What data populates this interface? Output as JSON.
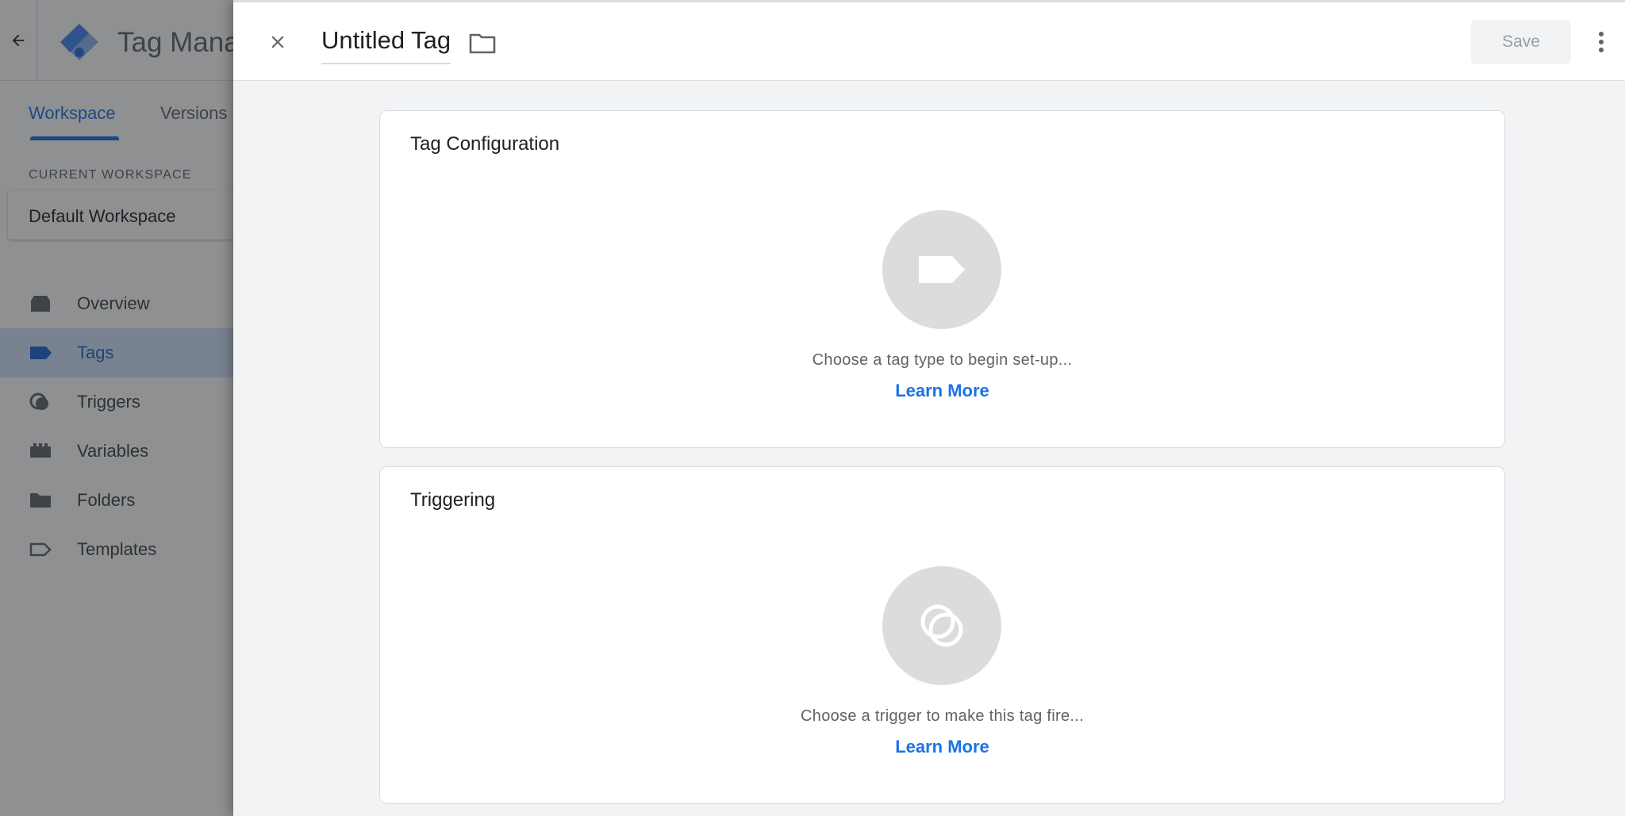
{
  "app": {
    "title": "Tag Manager",
    "tabs": [
      {
        "label": "Workspace"
      },
      {
        "label": "Versions"
      }
    ],
    "current_workspace_label": "CURRENT WORKSPACE",
    "current_workspace_name": "Default Workspace",
    "nav": [
      {
        "label": "Overview",
        "icon": "overview-icon"
      },
      {
        "label": "Tags",
        "icon": "tag-icon",
        "active": true
      },
      {
        "label": "Triggers",
        "icon": "trigger-icon"
      },
      {
        "label": "Variables",
        "icon": "variables-icon"
      },
      {
        "label": "Folders",
        "icon": "folder-icon"
      },
      {
        "label": "Templates",
        "icon": "template-icon"
      }
    ]
  },
  "editor": {
    "title": "Untitled Tag",
    "save_label": "Save",
    "tag_config": {
      "title": "Tag Configuration",
      "description": "Choose a tag type to begin set-up...",
      "link": "Learn More"
    },
    "triggering": {
      "title": "Triggering",
      "description": "Choose a trigger to make this tag fire...",
      "link": "Learn More"
    }
  },
  "colors": {
    "accent": "#1a73e8",
    "active_nav_bg": "#d2e3fc",
    "panel_bg": "#f1f3f4",
    "placeholder_circle": "#dcdcdc"
  }
}
